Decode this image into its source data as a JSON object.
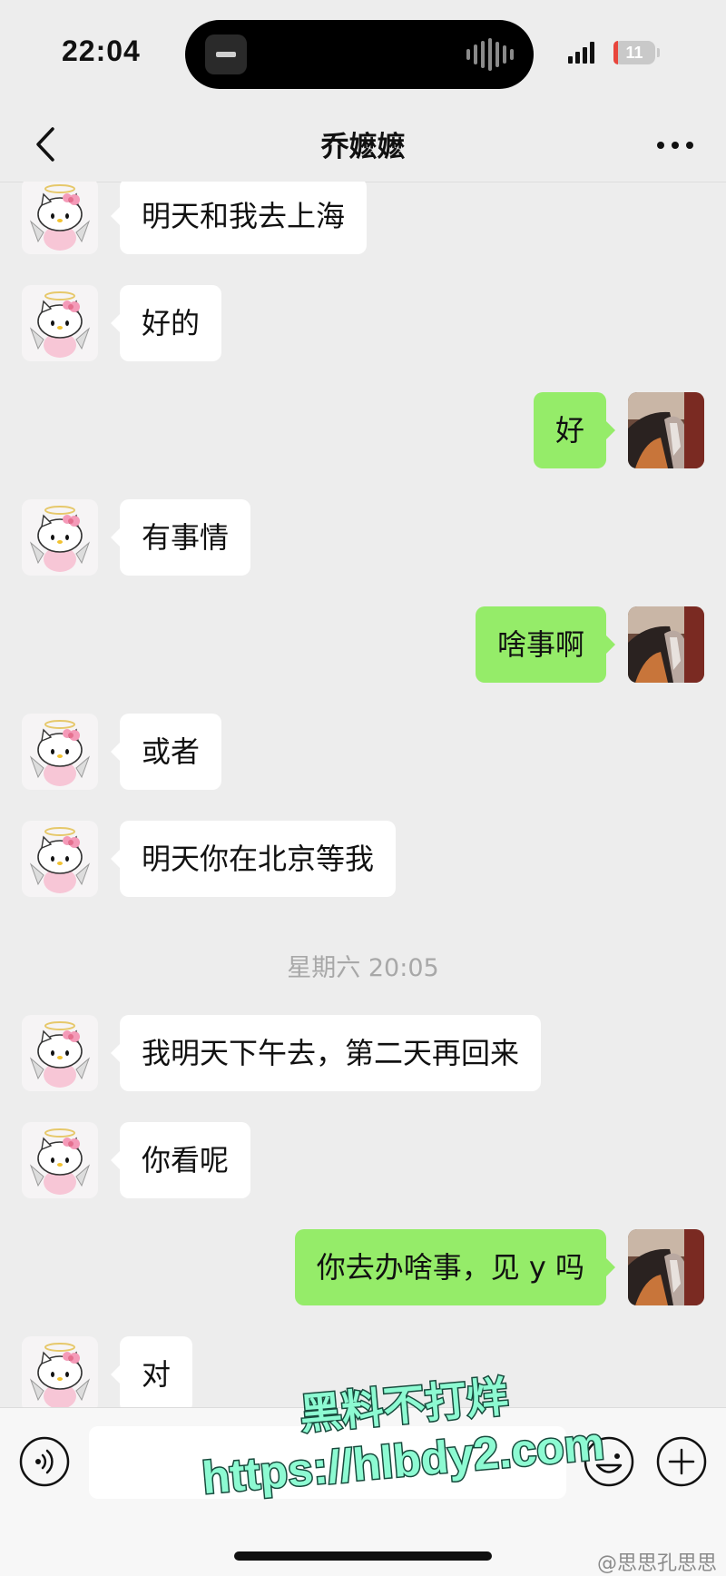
{
  "status_bar": {
    "time": "22:04",
    "battery": "11",
    "battery_level": 0.11,
    "battery_color": "#e8453c"
  },
  "header": {
    "title": "乔嬷嬷"
  },
  "messages": [
    {
      "side": "in",
      "text": "明天和我去上海"
    },
    {
      "side": "in",
      "text": "好的"
    },
    {
      "side": "out",
      "text": "好"
    },
    {
      "side": "in",
      "text": "有事情"
    },
    {
      "side": "out",
      "text": "啥事啊"
    },
    {
      "side": "in",
      "text": "或者"
    },
    {
      "side": "in",
      "text": "明天你在北京等我"
    },
    {
      "type": "time",
      "text": "星期六 20:05"
    },
    {
      "side": "in",
      "text": "我明天下午去，第二天再回来"
    },
    {
      "side": "in",
      "text": "你看呢"
    },
    {
      "side": "out",
      "text": "你去办啥事，见 y 吗"
    },
    {
      "side": "in",
      "text": "对"
    }
  ],
  "input": {
    "value": ""
  },
  "icons": [
    "back-chevron-icon",
    "more-dots-icon",
    "voice-icon",
    "emoji-icon",
    "plus-icon"
  ],
  "colors": {
    "background": "#ededed",
    "bubble_in": "#ffffff",
    "bubble_out": "#95ec69"
  },
  "watermark": {
    "line1": "黑料不打烊",
    "line2": "https://hlbdy2.com",
    "source": "@思思孔思思"
  }
}
